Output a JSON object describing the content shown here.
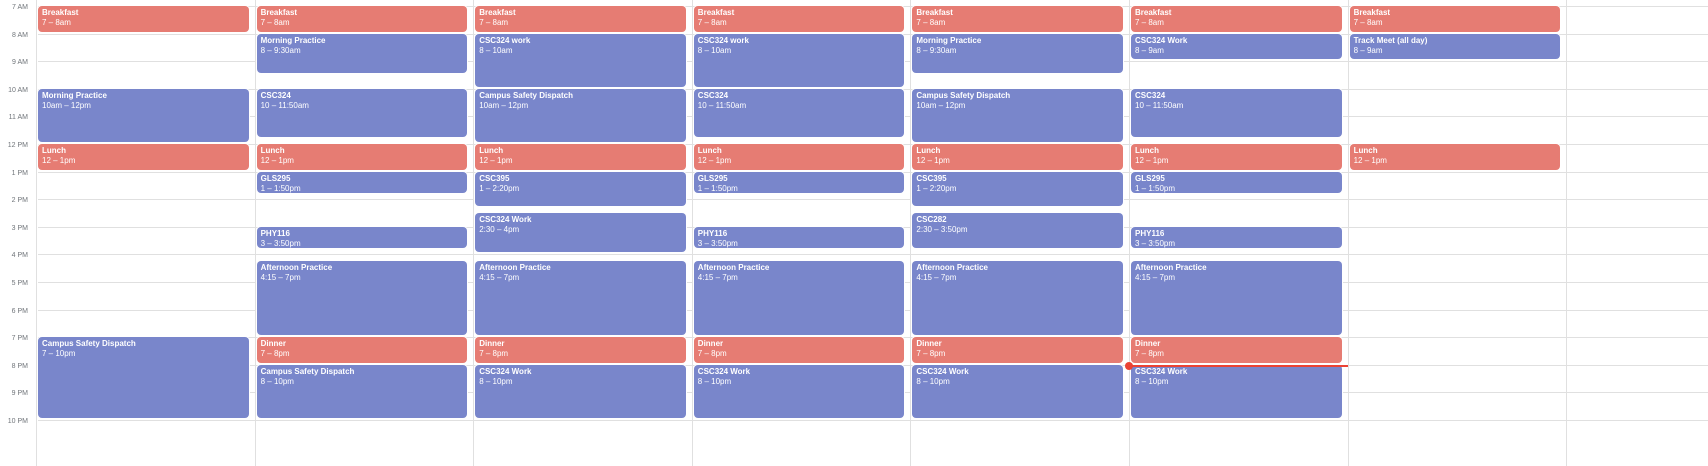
{
  "colors": {
    "blue": "#7986cb",
    "red": "#e67c73",
    "now_indicator": "#ea4335",
    "grid": "#e0e0e0"
  },
  "hour_labels": [
    "7 AM",
    "8 AM",
    "9 AM",
    "10 AM",
    "11 AM",
    "12 PM",
    "1 PM",
    "2 PM",
    "3 PM",
    "4 PM",
    "5 PM",
    "6 PM",
    "7 PM",
    "8 PM",
    "9 PM",
    "10 PM"
  ],
  "current_time": {
    "day": 5,
    "hour": 20
  },
  "days": [
    {
      "events": [
        {
          "title": "Breakfast",
          "time": "7 – 8am",
          "start": 7,
          "end": 8,
          "color": "red"
        },
        {
          "title": "Morning Practice",
          "time": "10am – 12pm",
          "start": 10,
          "end": 12,
          "color": "blue"
        },
        {
          "title": "Lunch",
          "time": "12 – 1pm",
          "start": 12,
          "end": 13,
          "color": "red"
        },
        {
          "title": "Campus Safety Dispatch",
          "time": "7 – 10pm",
          "start": 19,
          "end": 22,
          "color": "blue"
        }
      ]
    },
    {
      "events": [
        {
          "title": "Breakfast",
          "time": "7 – 8am",
          "start": 7,
          "end": 8,
          "color": "red"
        },
        {
          "title": "Morning Practice",
          "time": "8 – 9:30am",
          "start": 8,
          "end": 9.5,
          "color": "blue"
        },
        {
          "title": "CSC324",
          "time": "10 – 11:50am",
          "start": 10,
          "end": 11.833,
          "color": "blue"
        },
        {
          "title": "Lunch",
          "time": "12 – 1pm",
          "start": 12,
          "end": 13,
          "color": "red"
        },
        {
          "title": "GLS295",
          "time": "1 – 1:50pm",
          "start": 13,
          "end": 13.833,
          "color": "blue"
        },
        {
          "title": "PHY116",
          "time": "3 – 3:50pm",
          "start": 15,
          "end": 15.833,
          "color": "blue"
        },
        {
          "title": "Afternoon Practice",
          "time": "4:15 – 7pm",
          "start": 16.25,
          "end": 19,
          "color": "blue"
        },
        {
          "title": "Dinner",
          "time": "7 – 8pm",
          "start": 19,
          "end": 20,
          "color": "red"
        },
        {
          "title": "Campus Safety Dispatch",
          "time": "8 – 10pm",
          "start": 20,
          "end": 22,
          "color": "blue"
        }
      ]
    },
    {
      "events": [
        {
          "title": "Breakfast",
          "time": "7 – 8am",
          "start": 7,
          "end": 8,
          "color": "red"
        },
        {
          "title": "CSC324 work",
          "time": "8 – 10am",
          "start": 8,
          "end": 10,
          "color": "blue"
        },
        {
          "title": "Campus Safety Dispatch",
          "time": "10am – 12pm",
          "start": 10,
          "end": 12,
          "color": "blue"
        },
        {
          "title": "Lunch",
          "time": "12 – 1pm",
          "start": 12,
          "end": 13,
          "color": "red"
        },
        {
          "title": "CSC395",
          "time": "1 – 2:20pm",
          "start": 13,
          "end": 14.333,
          "color": "blue"
        },
        {
          "title": "CSC324 Work",
          "time": "2:30 – 4pm",
          "start": 14.5,
          "end": 16,
          "color": "blue"
        },
        {
          "title": "Afternoon Practice",
          "time": "4:15 – 7pm",
          "start": 16.25,
          "end": 19,
          "color": "blue"
        },
        {
          "title": "Dinner",
          "time": "7 – 8pm",
          "start": 19,
          "end": 20,
          "color": "red"
        },
        {
          "title": "CSC324 Work",
          "time": "8 – 10pm",
          "start": 20,
          "end": 22,
          "color": "blue"
        }
      ]
    },
    {
      "events": [
        {
          "title": "Breakfast",
          "time": "7 – 8am",
          "start": 7,
          "end": 8,
          "color": "red"
        },
        {
          "title": "CSC324 work",
          "time": "8 – 10am",
          "start": 8,
          "end": 10,
          "color": "blue"
        },
        {
          "title": "CSC324",
          "time": "10 – 11:50am",
          "start": 10,
          "end": 11.833,
          "color": "blue"
        },
        {
          "title": "Lunch",
          "time": "12 – 1pm",
          "start": 12,
          "end": 13,
          "color": "red"
        },
        {
          "title": "GLS295",
          "time": "1 – 1:50pm",
          "start": 13,
          "end": 13.833,
          "color": "blue"
        },
        {
          "title": "PHY116",
          "time": "3 – 3:50pm",
          "start": 15,
          "end": 15.833,
          "color": "blue"
        },
        {
          "title": "Afternoon Practice",
          "time": "4:15 – 7pm",
          "start": 16.25,
          "end": 19,
          "color": "blue"
        },
        {
          "title": "Dinner",
          "time": "7 – 8pm",
          "start": 19,
          "end": 20,
          "color": "red"
        },
        {
          "title": "CSC324 Work",
          "time": "8 – 10pm",
          "start": 20,
          "end": 22,
          "color": "blue"
        }
      ]
    },
    {
      "events": [
        {
          "title": "Breakfast",
          "time": "7 – 8am",
          "start": 7,
          "end": 8,
          "color": "red"
        },
        {
          "title": "Morning Practice",
          "time": "8 – 9:30am",
          "start": 8,
          "end": 9.5,
          "color": "blue"
        },
        {
          "title": "Campus Safety Dispatch",
          "time": "10am – 12pm",
          "start": 10,
          "end": 12,
          "color": "blue"
        },
        {
          "title": "Lunch",
          "time": "12 – 1pm",
          "start": 12,
          "end": 13,
          "color": "red"
        },
        {
          "title": "CSC395",
          "time": "1 – 2:20pm",
          "start": 13,
          "end": 14.333,
          "color": "blue"
        },
        {
          "title": "CSC282",
          "time": "2:30 – 3:50pm",
          "start": 14.5,
          "end": 15.833,
          "color": "blue"
        },
        {
          "title": "Afternoon Practice",
          "time": "4:15 – 7pm",
          "start": 16.25,
          "end": 19,
          "color": "blue"
        },
        {
          "title": "Dinner",
          "time": "7 – 8pm",
          "start": 19,
          "end": 20,
          "color": "red"
        },
        {
          "title": "CSC324 Work",
          "time": "8 – 10pm",
          "start": 20,
          "end": 22,
          "color": "blue"
        }
      ]
    },
    {
      "events": [
        {
          "title": "Breakfast",
          "time": "7 – 8am",
          "start": 7,
          "end": 8,
          "color": "red"
        },
        {
          "title": "CSC324 Work",
          "time": "8 – 9am",
          "start": 8,
          "end": 9,
          "color": "blue"
        },
        {
          "title": "CSC324",
          "time": "10 – 11:50am",
          "start": 10,
          "end": 11.833,
          "color": "blue"
        },
        {
          "title": "Lunch",
          "time": "12 – 1pm",
          "start": 12,
          "end": 13,
          "color": "red"
        },
        {
          "title": "GLS295",
          "time": "1 – 1:50pm",
          "start": 13,
          "end": 13.833,
          "color": "blue"
        },
        {
          "title": "PHY116",
          "time": "3 – 3:50pm",
          "start": 15,
          "end": 15.833,
          "color": "blue"
        },
        {
          "title": "Afternoon Practice",
          "time": "4:15 – 7pm",
          "start": 16.25,
          "end": 19,
          "color": "blue"
        },
        {
          "title": "Dinner",
          "time": "7 – 8pm",
          "start": 19,
          "end": 20,
          "color": "red"
        },
        {
          "title": "CSC324 Work",
          "time": "8 – 10pm",
          "start": 20,
          "end": 22,
          "color": "blue"
        }
      ]
    },
    {
      "events": [
        {
          "title": "Breakfast",
          "time": "7 – 8am",
          "start": 7,
          "end": 8,
          "color": "red"
        },
        {
          "title": "Track Meet (all day)",
          "time": "8 – 9am",
          "start": 8,
          "end": 9,
          "color": "blue"
        },
        {
          "title": "Lunch",
          "time": "12 – 1pm",
          "start": 12,
          "end": 13,
          "color": "red"
        }
      ]
    }
  ]
}
